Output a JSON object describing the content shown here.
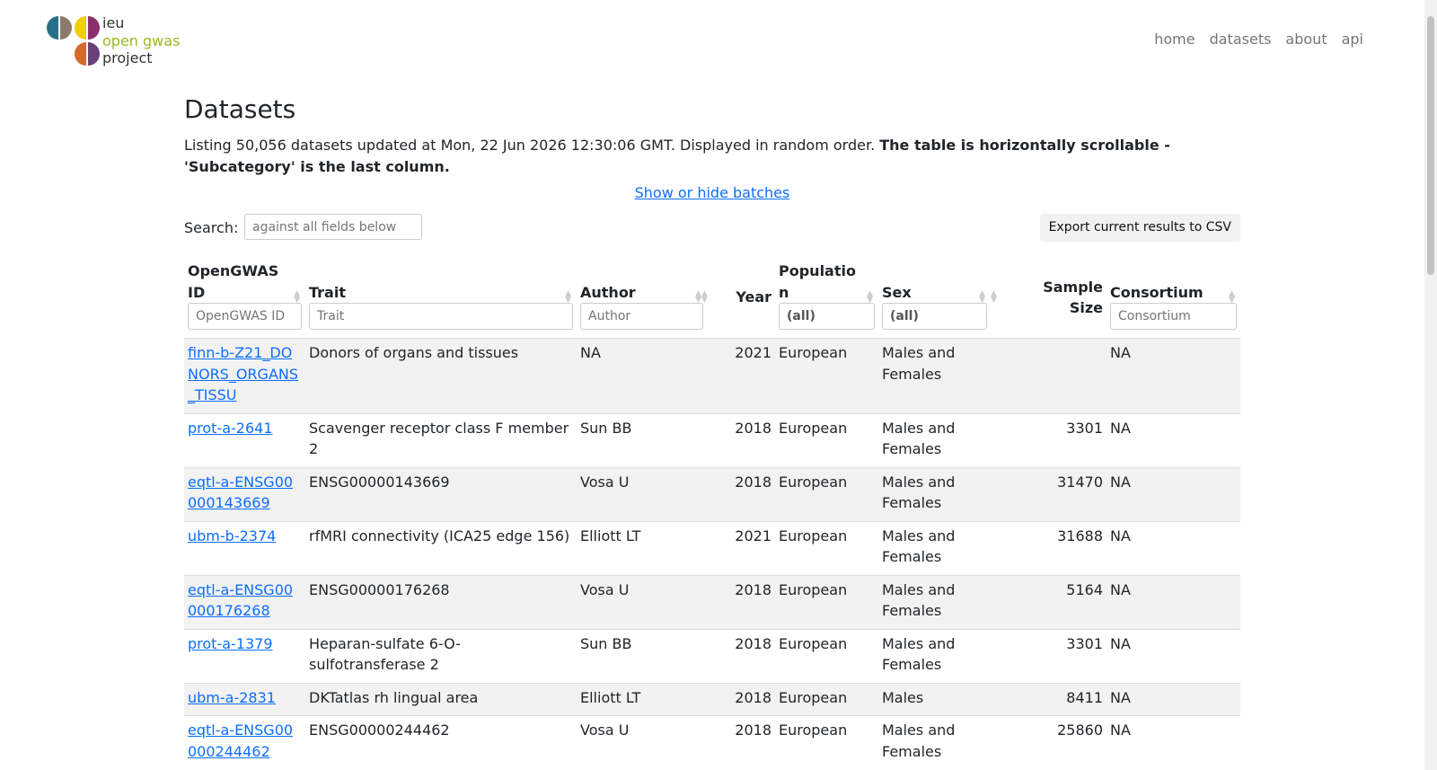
{
  "logo": {
    "lines": [
      "ieu",
      "open gwas",
      "project"
    ],
    "colors": [
      "#2a6f8a",
      "#8c7b6b",
      "#f0d000",
      "#8b2f6b",
      "#d46a2b",
      "#6a3f7a",
      "#9ab81e"
    ]
  },
  "nav": {
    "home": "home",
    "datasets": "datasets",
    "about": "about",
    "api": "api"
  },
  "page": {
    "title": "Datasets",
    "listing_text": "Listing 50,056 datasets updated at Mon, 22 Jun 2026 12:30:06 GMT. Displayed in random order.",
    "listing_bold": "The table is horizontally scrollable - 'Subcategory' is the last column.",
    "batches_link": "Show or hide batches",
    "search_label": "Search:",
    "search_placeholder": "against all fields below",
    "export_button": "Export current results to CSV"
  },
  "table": {
    "headers": {
      "id": "OpenGWAS ID",
      "trait": "Trait",
      "author": "Author",
      "year": "Year",
      "population": "Population",
      "sex": "Sex",
      "sample_size": "Sample Size",
      "consortium": "Consortium"
    },
    "filters": {
      "id": "OpenGWAS ID",
      "trait": "Trait",
      "author": "Author",
      "population": "(all)",
      "sex": "(all)",
      "consortium": "Consortium"
    },
    "rows": [
      {
        "id": "finn-b-Z21_DONORS_ORGANS_TISSU",
        "trait": "Donors of organs and tissues",
        "author": "NA",
        "year": "2021",
        "population": "European",
        "sex": "Males and Females",
        "sample_size": "",
        "consortium": "NA"
      },
      {
        "id": "prot-a-2641",
        "trait": "Scavenger receptor class F member 2",
        "author": "Sun BB",
        "year": "2018",
        "population": "European",
        "sex": "Males and Females",
        "sample_size": "3301",
        "consortium": "NA"
      },
      {
        "id": "eqtl-a-ENSG00000143669",
        "trait": "ENSG00000143669",
        "author": "Vosa U",
        "year": "2018",
        "population": "European",
        "sex": "Males and Females",
        "sample_size": "31470",
        "consortium": "NA"
      },
      {
        "id": "ubm-b-2374",
        "trait": "rfMRI connectivity (ICA25 edge 156)",
        "author": "Elliott LT",
        "year": "2021",
        "population": "European",
        "sex": "Males and Females",
        "sample_size": "31688",
        "consortium": "NA"
      },
      {
        "id": "eqtl-a-ENSG00000176268",
        "trait": "ENSG00000176268",
        "author": "Vosa U",
        "year": "2018",
        "population": "European",
        "sex": "Males and Females",
        "sample_size": "5164",
        "consortium": "NA"
      },
      {
        "id": "prot-a-1379",
        "trait": "Heparan-sulfate 6-O-sulfotransferase 2",
        "author": "Sun BB",
        "year": "2018",
        "population": "European",
        "sex": "Males and Females",
        "sample_size": "3301",
        "consortium": "NA"
      },
      {
        "id": "ubm-a-2831",
        "trait": "DKTatlas rh lingual area",
        "author": "Elliott LT",
        "year": "2018",
        "population": "European",
        "sex": "Males",
        "sample_size": "8411",
        "consortium": "NA"
      },
      {
        "id": "eqtl-a-ENSG00000244462",
        "trait": "ENSG00000244462",
        "author": "Vosa U",
        "year": "2018",
        "population": "European",
        "sex": "Males and Females",
        "sample_size": "25860",
        "consortium": "NA"
      }
    ]
  }
}
